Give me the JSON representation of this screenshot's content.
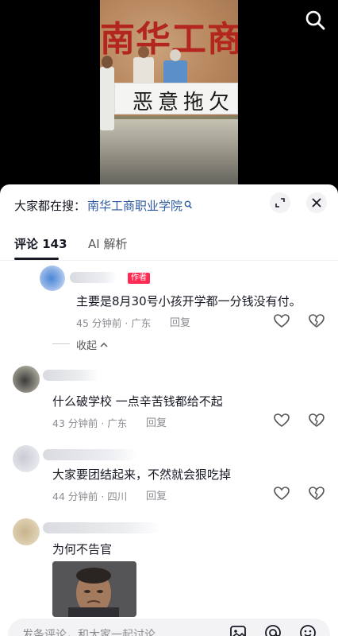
{
  "video": {
    "wall_sign": "南华工商",
    "banner_text": "恶意拖欠"
  },
  "sheet": {
    "hot_prefix": "大家都在搜：",
    "hot_term": "南华工商职业学院",
    "tabs": [
      {
        "label": "评论 143"
      },
      {
        "label": "AI 解析"
      }
    ]
  },
  "comments": [
    {
      "badge": "作者",
      "text": "主要是8月30号小孩开学都一分钱没有付。",
      "meta": "45 分钟前 · 广东",
      "reply": "回复"
    },
    {
      "text": "什么破学校  一点辛苦钱都给不起",
      "meta": "43 分钟前 · 广东",
      "reply": "回复"
    },
    {
      "text": "大家要团结起来，不然就会狠吃掉",
      "meta": "44 分钟前 · 四川",
      "reply": "回复"
    },
    {
      "text": "为何不告官"
    }
  ],
  "collapse_label": "收起",
  "input": {
    "placeholder": "发条评论，和大家一起讨论"
  }
}
